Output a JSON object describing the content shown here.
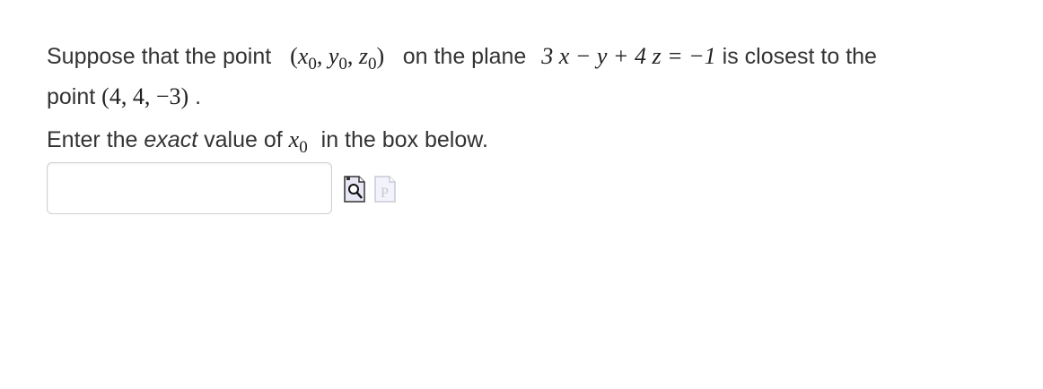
{
  "problem": {
    "s1_a": "Suppose that the point",
    "pt_open": "(",
    "x0": "x",
    "y0": "y",
    "z0": "z",
    "sub0": "0",
    "comma": ",",
    "pt_close": ")",
    "s1_b": "on the plane",
    "plane": "3 x − y + 4 z = −1",
    "s1_c": "is closest to the",
    "s2_a": "point",
    "point": "(4, 4, −3)",
    "s2_b": ".",
    "s3_a": "Enter the",
    "s3_em": "exact",
    "s3_b": "value of",
    "s3_var": "x",
    "s3_sub": "0",
    "s3_c": "in the box below."
  },
  "answer": {
    "value": "",
    "placeholder": ""
  },
  "icons": {
    "preview": "preview-magnifier-icon",
    "problem": "problem-page-icon"
  }
}
